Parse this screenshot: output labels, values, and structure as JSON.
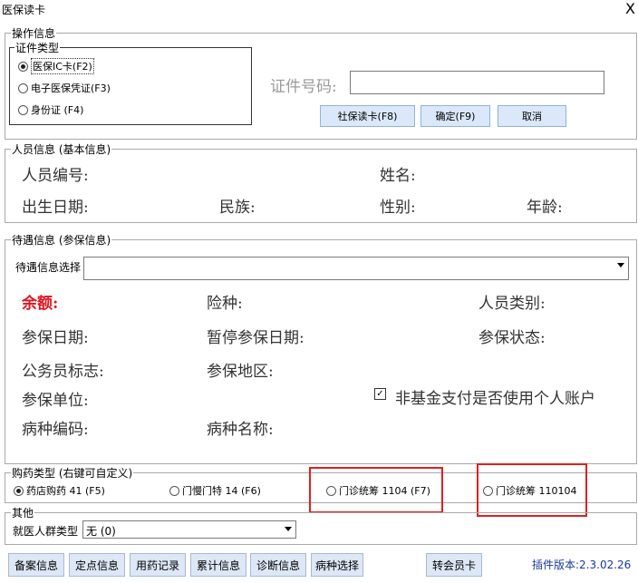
{
  "window": {
    "title": "医保读卡",
    "close": "X"
  },
  "operation": {
    "legend": "操作信息",
    "cert_type_legend": "证件类型",
    "radios": [
      {
        "label": "医保IC卡(F2)",
        "selected": true
      },
      {
        "label": "电子医保凭证(F3)",
        "selected": false
      },
      {
        "label": "身份证 (F4)",
        "selected": false
      }
    ],
    "cert_no_label": "证件号码:",
    "cert_no_value": "",
    "buttons": {
      "read": "社保读卡(F8)",
      "confirm": "确定(F9)",
      "cancel": "取消"
    }
  },
  "person": {
    "legend": "人员信息 (基本信息)",
    "labels": {
      "id": "人员编号:",
      "name": "姓名:",
      "birth": "出生日期:",
      "ethnic": "民族:",
      "gender": "性别:",
      "age": "年龄:"
    }
  },
  "treatment": {
    "legend": "待遇信息 (参保信息)",
    "select_label": "待遇信息选择",
    "select_value": "",
    "labels": {
      "balance": "余额:",
      "insurance_type": "险种:",
      "person_category": "人员类别:",
      "insured_date": "参保日期:",
      "suspend_date": "暂停参保日期:",
      "insured_status": "参保状态:",
      "civil_servant": "公务员标志:",
      "insured_region": "参保地区:",
      "insured_unit": "参保单位:",
      "non_fund_account": "非基金支付是否使用个人账户",
      "disease_code": "病种编码:",
      "disease_name": "病种名称:"
    },
    "non_fund_checked": true
  },
  "purchase": {
    "legend": "购药类型 (右键可自定义)",
    "options": [
      {
        "label": "药店购药 41 (F5)",
        "selected": true
      },
      {
        "label": "门慢门特 14 (F6)",
        "selected": false
      },
      {
        "label": "门诊统筹 1104 (F7)",
        "selected": false
      },
      {
        "label": "门诊统筹 110104",
        "selected": false
      }
    ]
  },
  "other": {
    "legend": "其他",
    "crowd_label": "就医人群类型",
    "crowd_value": "无 (0)"
  },
  "footer": {
    "buttons": [
      "备案信息",
      "定点信息",
      "用药记录",
      "累计信息",
      "诊断信息",
      "病种选择",
      "转会员卡"
    ],
    "version": "插件版本:2.3.02.26"
  },
  "colors": {
    "highlight": "#e02020",
    "balance": "#e0141e",
    "version": "#1a3a9a"
  }
}
